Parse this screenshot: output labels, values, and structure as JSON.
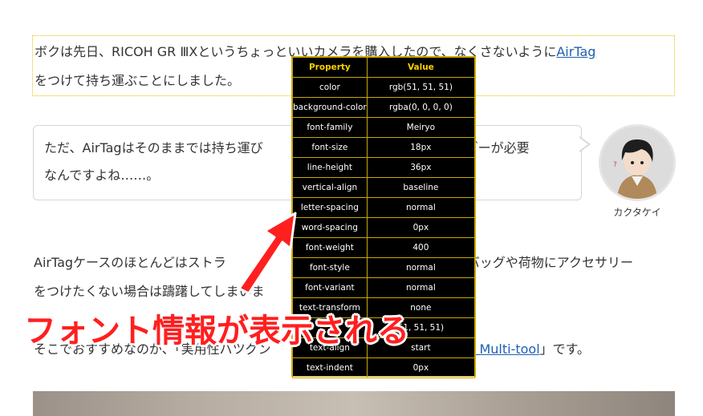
{
  "article": {
    "p1": {
      "line1_text": "ボクは先日、RICOH GR ⅢXというちょっといいカメラを購入したので、なくさないように",
      "line1_link": "AirTag",
      "line2_text": "をつけて持ち運ぶことにしました。"
    },
    "speech": {
      "line1": "ただ、AirTagはそのままでは持ち運び",
      "line1_end": "ルダーが必要",
      "line2": "なんですよね……。",
      "speaker_name": "カクタケイ"
    },
    "p3": {
      "line1_start": "AirTagケースのほとんどはストラ",
      "line1_end": "バッグや荷物にアクセサリー",
      "line2": "をつけたくない場合は躊躇してしまいま"
    },
    "p4": {
      "text_start": "そこでおすすめなのが、「実用性バツグン",
      "link_text": "itaTag for Multi-tool",
      "text_end": "」です。"
    }
  },
  "devtools_panel": {
    "header_property": "Property",
    "header_value": "Value",
    "rows": [
      {
        "property": "color",
        "value": "rgb(51, 51, 51)"
      },
      {
        "property": "background-color",
        "value": "rgba(0, 0, 0, 0)"
      },
      {
        "property": "font-family",
        "value": "Meiryo"
      },
      {
        "property": "font-size",
        "value": "18px"
      },
      {
        "property": "line-height",
        "value": "36px"
      },
      {
        "property": "vertical-align",
        "value": "baseline"
      },
      {
        "property": "letter-spacing",
        "value": "normal"
      },
      {
        "property": "word-spacing",
        "value": "0px"
      },
      {
        "property": "font-weight",
        "value": "400"
      },
      {
        "property": "font-style",
        "value": "normal"
      },
      {
        "property": "font-variant",
        "value": "normal"
      },
      {
        "property": "text-transform",
        "value": "none"
      },
      {
        "property": "",
        "value": "51, 51, 51)"
      },
      {
        "property": "text-align",
        "value": "start"
      },
      {
        "property": "text-indent",
        "value": "0px"
      }
    ]
  },
  "annotation": {
    "caption": "フォント情報が表示される",
    "color": "#ff1f1f",
    "icon": "red-arrow-icon"
  }
}
